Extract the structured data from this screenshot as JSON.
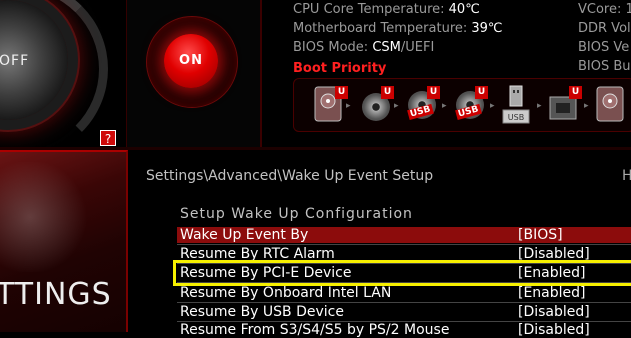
{
  "power": {
    "off_label": "OFF",
    "on_label": "ON",
    "help_label": "?"
  },
  "info": {
    "cpu_temp_label": "CPU Core Temperature:",
    "cpu_temp_value": "40℃",
    "mb_temp_label": "Motherboard Temperature:",
    "mb_temp_value": "39℃",
    "bios_mode_label": "BIOS Mode:",
    "bios_mode_value": "CSM",
    "bios_mode_suffix": "/UEFI",
    "right_col": [
      "VCore: 1",
      "DDR Vol",
      "BIOS Ve",
      "BIOS Bu"
    ]
  },
  "boot_priority": {
    "title": "Boot Priority",
    "badge": "U",
    "usb_text": "USB",
    "devices": [
      "hdd-icon",
      "optical-disc-icon",
      "usb-disc-icon",
      "usb-disc-icon",
      "usb-drive-icon",
      "network-card-icon",
      "hdd-icon"
    ]
  },
  "sidebar": {
    "settings_label": "TTINGS"
  },
  "main": {
    "breadcrumb": "Settings\\Advanced\\Wake Up Event Setup",
    "breadcrumb_right": "H",
    "section_title": "Setup Wake Up Configuration",
    "rows": [
      {
        "label": "Wake Up Event By",
        "value": "[BIOS]"
      },
      {
        "label": "Resume By RTC Alarm",
        "value": "[Disabled]"
      },
      {
        "label": "Resume By PCI-E Device",
        "value": "[Enabled]"
      },
      {
        "label": "Resume By Onboard Intel LAN",
        "value": "[Enabled]"
      },
      {
        "label": "Resume By USB Device",
        "value": "[Disabled]"
      },
      {
        "label": "Resume From S3/S4/S5 by PS/2 Mouse",
        "value": "[Disabled]"
      }
    ]
  },
  "colors": {
    "accent": "#cf0a0a",
    "selected_row": "#8c0c0c",
    "highlight": "#f6f000"
  }
}
